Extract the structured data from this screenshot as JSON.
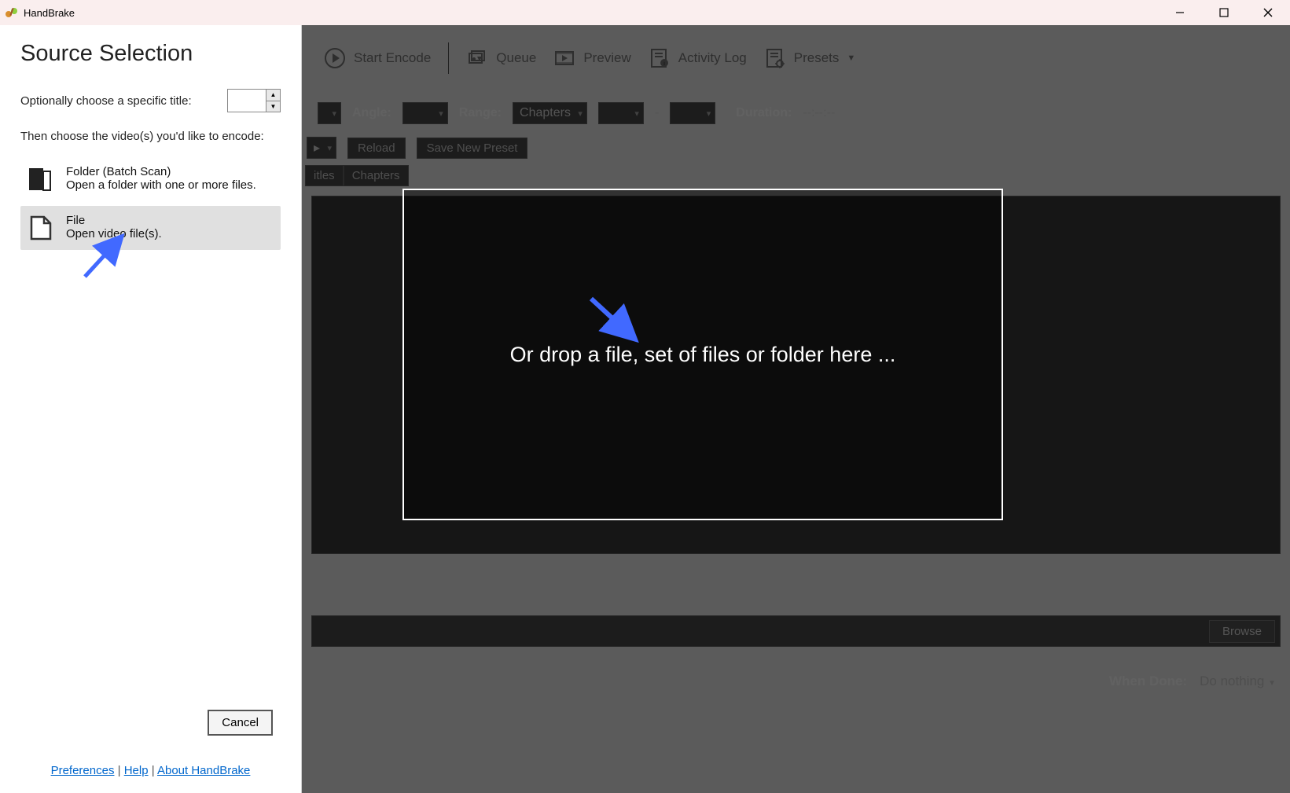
{
  "titlebar": {
    "title": "HandBrake"
  },
  "source_panel": {
    "heading": "Source Selection",
    "title_label": "Optionally choose a specific title:",
    "instruction": "Then choose the video(s) you'd like to encode:",
    "folder_option": {
      "line1": "Folder (Batch Scan)",
      "line2": "Open a folder with one or more files."
    },
    "file_option": {
      "line1": "File",
      "line2": "Open video file(s)."
    },
    "cancel": "Cancel",
    "links": {
      "preferences": "Preferences",
      "help": "Help",
      "about": "About HandBrake"
    }
  },
  "toolbar": {
    "start_encode": "Start Encode",
    "queue": "Queue",
    "preview": "Preview",
    "activity_log": "Activity Log",
    "presets": "Presets"
  },
  "controls": {
    "angle": "Angle:",
    "range": "Range:",
    "range_val": "Chapters",
    "dash": "-",
    "duration": "Duration:",
    "duration_val": "--:--:--",
    "reload": "Reload",
    "save_new_preset": "Save New Preset"
  },
  "tabs": {
    "itles": "itles",
    "chapters": "Chapters"
  },
  "dropzone": "Or drop a file, set of files or folder here ...",
  "browse": "Browse",
  "when_done": {
    "label": "When Done:",
    "value": "Do nothing"
  }
}
